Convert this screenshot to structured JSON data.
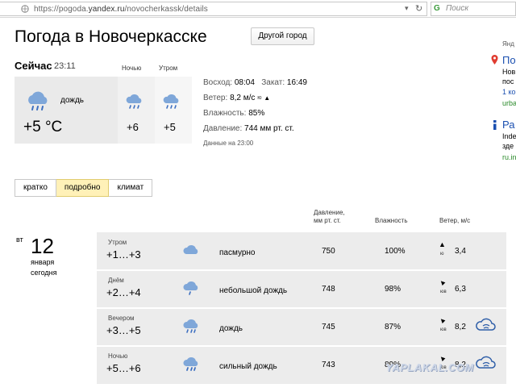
{
  "browser": {
    "url_prefix": "https://pogoda.",
    "url_domain": "yandex.ru",
    "url_path": "/novocherkassk/details",
    "search_placeholder": "Поиск",
    "search_logo": "G"
  },
  "header": {
    "title": "Погода в Новочеркасске",
    "other_city_button": "Другой город"
  },
  "now": {
    "label": "Сейчас",
    "time": "23:11",
    "condition": "дождь",
    "temperature": "+5 °C",
    "night_label": "Ночью",
    "night_temp": "+6",
    "morning_label": "Утром",
    "morning_temp": "+5"
  },
  "info": {
    "sunrise_label": "Восход:",
    "sunrise": "08:04",
    "sunset_label": "Закат:",
    "sunset": "16:49",
    "wind_label": "Ветер:",
    "wind": "8,2 м/с",
    "wind_dir": "ю",
    "humidity_label": "Влажность:",
    "humidity": "85%",
    "pressure_label": "Давление:",
    "pressure": "744 мм рт. ст.",
    "data_at": "Данные на 23:00"
  },
  "side": {
    "item1_line1": "Янд",
    "item1_title": "По",
    "item1_line2": "Нов",
    "item1_line3": "пос",
    "item1_link": "1 ко",
    "item1_url": "urba",
    "item2_title": "Ра",
    "item2_line1": "Inde",
    "item2_line2": "зде",
    "item2_url": "ru.in"
  },
  "tabs": [
    {
      "label": "кратко"
    },
    {
      "label": "подробно"
    },
    {
      "label": "климат"
    }
  ],
  "table": {
    "header_pressure_1": "Давление,",
    "header_pressure_2": "мм рт. ст.",
    "header_humidity": "Влажность",
    "header_wind": "Ветер, м/с",
    "day_weekday": "вт",
    "day_number": "12",
    "day_month": "января",
    "day_relative": "сегодня",
    "rows": [
      {
        "part": "Утром",
        "temp": "+1…+3",
        "cond": "пасмурно",
        "pressure": "750",
        "humidity": "100%",
        "wind_dir": "ю",
        "wind": "3,4"
      },
      {
        "part": "Днём",
        "temp": "+2…+4",
        "cond": "небольшой дождь",
        "pressure": "748",
        "humidity": "98%",
        "wind_dir": "юв",
        "wind": "6,3"
      },
      {
        "part": "Вечером",
        "temp": "+3…+5",
        "cond": "дождь",
        "pressure": "745",
        "humidity": "87%",
        "wind_dir": "юв",
        "wind": "8,2"
      },
      {
        "part": "Ночью",
        "temp": "+5…+6",
        "cond": "сильный дождь",
        "pressure": "743",
        "humidity": "89%",
        "wind_dir": "юв",
        "wind": "8,2"
      }
    ]
  },
  "watermark": "YAPLAKAL.COM",
  "colors": {
    "active_tab": "#fff1b8",
    "cloud": "#7fa7d9",
    "rain": "#3d6fc0"
  }
}
